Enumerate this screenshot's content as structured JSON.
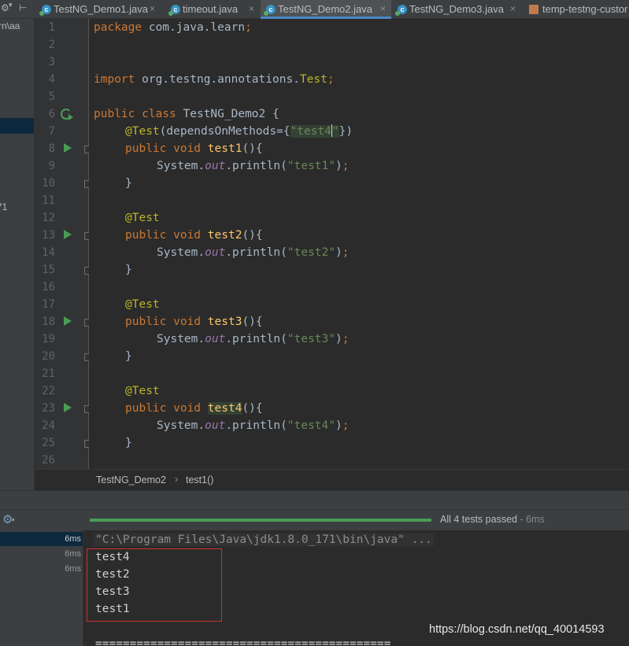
{
  "tabs": [
    {
      "label": "TestNG_Demo1.java",
      "icon": "java-class-icon",
      "active": false
    },
    {
      "label": "timeout.java",
      "icon": "java-class-icon",
      "active": false
    },
    {
      "label": "TestNG_Demo2.java",
      "icon": "java-class-icon",
      "active": true
    },
    {
      "label": "TestNG_Demo3.java",
      "icon": "java-class-icon",
      "active": false
    },
    {
      "label": "temp-testng-custor",
      "icon": "xml-file-icon",
      "active": false
    }
  ],
  "tab_close_glyph": "×",
  "project_panel": {
    "path_fragment": "rn\\aa",
    "item_fragment": "71"
  },
  "editor": {
    "line_numbers": [
      "1",
      "2",
      "3",
      "4",
      "5",
      "6",
      "7",
      "8",
      "9",
      "10",
      "11",
      "12",
      "13",
      "14",
      "15",
      "16",
      "17",
      "18",
      "19",
      "20",
      "21",
      "22",
      "23",
      "24",
      "25",
      "26"
    ],
    "code": {
      "package_kw": "package",
      "package_name": " com.java.learn",
      "import_kw": "import",
      "import_path": " org.testng.annotations.",
      "import_class": "Test",
      "semicolon": ";",
      "public": "public",
      "class_kw": " class",
      "class_name": " TestNG_Demo2 {",
      "void_kw": " void",
      "annotation": "@Test",
      "depends_open": "(dependsOnMethods={",
      "depends_str_open": "\"",
      "depends_value": "test4",
      "depends_str_close": "\"",
      "depends_close": "})",
      "methods": [
        "test1",
        "test2",
        "test3",
        "test4"
      ],
      "method_parens": "(){",
      "system": "System.",
      "out": "out",
      "println": ".println(",
      "prints": [
        "\"test1\"",
        "\"test2\"",
        "\"test3\"",
        "\"test4\""
      ],
      "close_paren_semi": ")",
      "close_brace": "}"
    }
  },
  "breadcrumb": {
    "class": "TestNG_Demo2",
    "separator": "›",
    "method": "test1()"
  },
  "run_panel": {
    "status_text": "All 4 tests passed",
    "status_duration": " - 6ms",
    "progress": 1.0,
    "tree_times": [
      "6ms",
      "6ms",
      "6ms"
    ]
  },
  "console": {
    "command": "\"C:\\Program Files\\Java\\jdk1.8.0_171\\bin\\java\" ...",
    "output": [
      "test4",
      "test2",
      "test3",
      "test1"
    ],
    "separator": "==========================================="
  },
  "watermark": "https://blog.csdn.net/qq_40014593"
}
